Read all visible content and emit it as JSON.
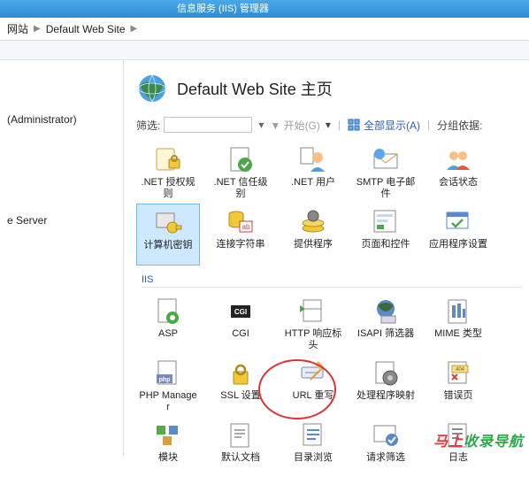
{
  "titlebar": {
    "text": "信息服务 (IIS) 管理器"
  },
  "breadcrumb": {
    "sep": "▶",
    "items": [
      "网站",
      "Default Web Site"
    ]
  },
  "sidebar": {
    "item1": "(Administrator)",
    "item2": "e Server"
  },
  "page": {
    "title": "Default Web Site 主页"
  },
  "filterbar": {
    "label": "筛选:",
    "start": "开始(G)",
    "showall": "全部显示(A)",
    "groupby": "分组依据:"
  },
  "sections": {
    "iis": "IIS"
  },
  "features": {
    "aspnet": [
      {
        "id": "net-auth",
        "label": ".NET 授权规则"
      },
      {
        "id": "net-trust",
        "label": ".NET 信任级别"
      },
      {
        "id": "net-users",
        "label": ".NET 用户"
      },
      {
        "id": "smtp",
        "label": "SMTP 电子邮件"
      },
      {
        "id": "session",
        "label": "会话状态"
      },
      {
        "id": "machinekey",
        "label": "计算机密钥"
      },
      {
        "id": "connstr",
        "label": "连接字符串"
      },
      {
        "id": "providers",
        "label": "提供程序"
      },
      {
        "id": "pagesctrl",
        "label": "页面和控件"
      },
      {
        "id": "appsettings",
        "label": "应用程序设置"
      }
    ],
    "iis": [
      {
        "id": "asp",
        "label": "ASP"
      },
      {
        "id": "cgi",
        "label": "CGI"
      },
      {
        "id": "httpresp",
        "label": "HTTP 响应标头"
      },
      {
        "id": "isapi",
        "label": "ISAPI 筛选器"
      },
      {
        "id": "mime",
        "label": "MIME 类型"
      },
      {
        "id": "phpmgr",
        "label": "PHP Manager"
      },
      {
        "id": "ssl",
        "label": "SSL 设置"
      },
      {
        "id": "urlrewrite",
        "label": "URL 重写"
      },
      {
        "id": "handlers",
        "label": "处理程序映射"
      },
      {
        "id": "errorpages",
        "label": "错误页"
      },
      {
        "id": "modules",
        "label": "模块"
      },
      {
        "id": "defaultdoc",
        "label": "默认文档"
      },
      {
        "id": "dirbrowse",
        "label": "目录浏览"
      },
      {
        "id": "reqfilter",
        "label": "请求筛选"
      },
      {
        "id": "logging",
        "label": "日志"
      }
    ]
  },
  "watermark": {
    "part1": "马上",
    "part2": "收录导航"
  }
}
